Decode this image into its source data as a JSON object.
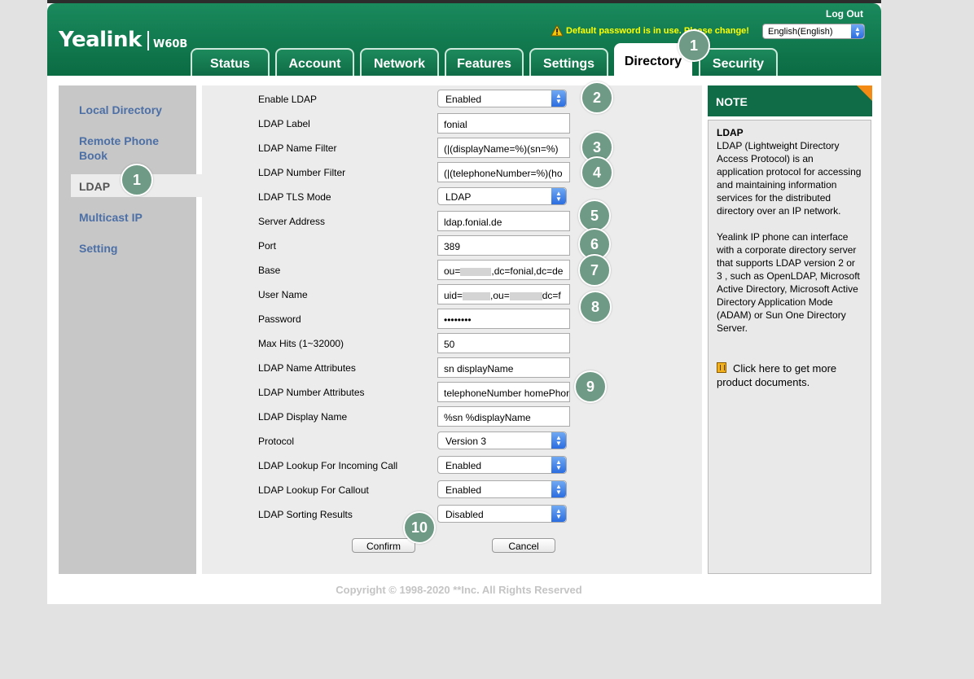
{
  "header": {
    "brand": "Yealink",
    "model": "W60B",
    "logout": "Log Out",
    "warning": "Default password is in use. Please change!",
    "language": "English(English)"
  },
  "tabs": [
    "Status",
    "Account",
    "Network",
    "Features",
    "Settings",
    "Directory",
    "Security"
  ],
  "active_tab": "Directory",
  "sidebar": {
    "items": [
      "Local Directory",
      "Remote Phone Book",
      "LDAP",
      "Multicast IP",
      "Setting"
    ],
    "active": "LDAP"
  },
  "form": {
    "enable_ldap": {
      "label": "Enable LDAP",
      "value": "Enabled"
    },
    "ldap_label": {
      "label": "LDAP Label",
      "value": "fonial"
    },
    "name_filter": {
      "label": "LDAP Name Filter",
      "value": "(|(displayName=%)(sn=%)"
    },
    "number_filter": {
      "label": "LDAP Number Filter",
      "value": "(|(telephoneNumber=%)(ho"
    },
    "tls_mode": {
      "label": "LDAP TLS Mode",
      "value": "LDAP"
    },
    "server_address": {
      "label": "Server Address",
      "value": "ldap.fonial.de"
    },
    "port": {
      "label": "Port",
      "value": "389"
    },
    "base": {
      "label": "Base",
      "value_prefix": "ou=",
      "value_suffix": ",dc=fonial,dc=de"
    },
    "user_name": {
      "label": "User Name",
      "value_prefix": "uid=",
      "value_middle": ",ou=",
      "value_suffix": "dc=f"
    },
    "password": {
      "label": "Password",
      "value": "••••••••"
    },
    "max_hits": {
      "label": "Max Hits (1~32000)",
      "value": "50"
    },
    "name_attributes": {
      "label": "LDAP Name Attributes",
      "value": "sn displayName"
    },
    "number_attributes": {
      "label": "LDAP Number Attributes",
      "value": "telephoneNumber homePhon"
    },
    "display_name": {
      "label": "LDAP Display Name",
      "value": "%sn %displayName"
    },
    "protocol": {
      "label": "Protocol",
      "value": "Version 3"
    },
    "lookup_incoming": {
      "label": "LDAP Lookup For Incoming Call",
      "value": "Enabled"
    },
    "lookup_callout": {
      "label": "LDAP Lookup For Callout",
      "value": "Enabled"
    },
    "sorting": {
      "label": "LDAP Sorting Results",
      "value": "Disabled"
    }
  },
  "buttons": {
    "confirm": "Confirm",
    "cancel": "Cancel"
  },
  "note": {
    "heading": "NOTE",
    "title": "LDAP",
    "p1": "LDAP (Lightweight Directory Access Protocol) is an application protocol for accessing and maintaining information services for the distributed directory over an IP network.",
    "p2": "Yealink IP phone can interface with a corporate directory server that supports LDAP version 2 or 3 , such as OpenLDAP, Microsoft Active Directory, Microsoft Active Directory Application Mode (ADAM) or Sun One Directory Server.",
    "link": "Click here to get more product documents."
  },
  "copyright": "Copyright © 1998-2020 **Inc. All Rights Reserved",
  "badges": [
    "1",
    "1",
    "2",
    "3",
    "4",
    "5",
    "6",
    "7",
    "8",
    "9",
    "10"
  ],
  "colors": {
    "brand_green": "#0f6c46",
    "warning_yellow": "#ffff00",
    "sidebar_link": "#4c6fa6",
    "badge": "#6f9a85",
    "note_corner": "#f28a14"
  }
}
